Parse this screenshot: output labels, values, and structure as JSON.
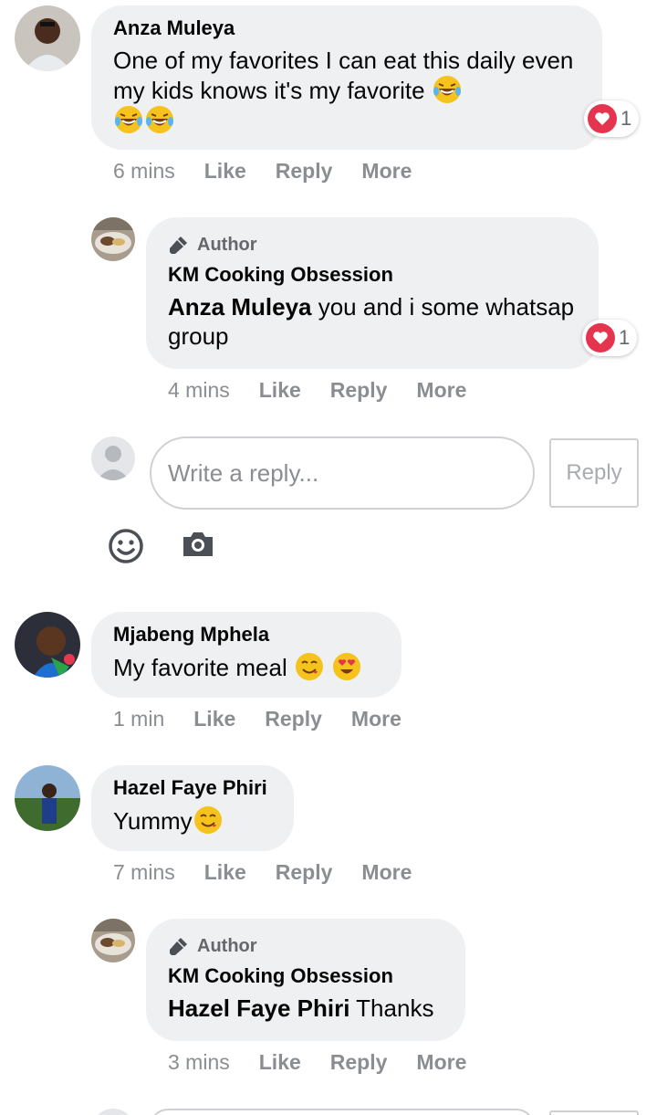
{
  "comments": [
    {
      "name": "Anza Muleya",
      "text": "One of my favorites I can eat this daily even my kids knows it's my favorite",
      "reaction_count": "1",
      "time": "6 mins",
      "avatar_icon": "person-photo"
    },
    {
      "author_badge": "Author",
      "name": "KM Cooking Obsession",
      "mention": "Anza Muleya",
      "text": " you and i some whatsap group",
      "reaction_count": "1",
      "time": "4 mins",
      "avatar_icon": "food-photo"
    },
    {
      "name": "Mjabeng Mphela",
      "text": "My favorite meal",
      "time": "1 min",
      "avatar_icon": "person-photo"
    },
    {
      "name": "Hazel Faye Phiri",
      "text": "Yummy",
      "time": "7 mins",
      "avatar_icon": "person-photo"
    },
    {
      "author_badge": "Author",
      "name": "KM Cooking Obsession",
      "mention": "Hazel Faye Phiri",
      "text": " Thanks",
      "time": "3 mins",
      "avatar_icon": "food-photo"
    }
  ],
  "actions": {
    "like": "Like",
    "reply": "Reply",
    "more": "More"
  },
  "reply_box": {
    "placeholder": "Write a reply...",
    "button": "Reply"
  },
  "colors": {
    "bubble": "#eff0f2",
    "meta": "#8a8d91",
    "heart": "#e5344e"
  }
}
